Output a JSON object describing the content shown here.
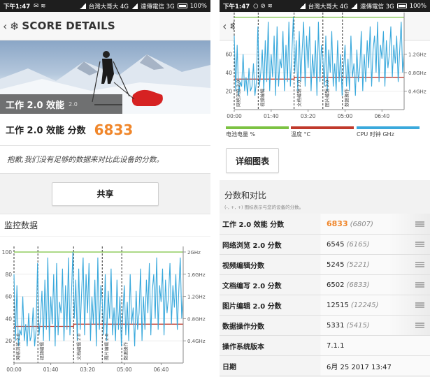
{
  "status_left": {
    "time": "下午1:47",
    "carrier1": "台灣大哥大 4G",
    "carrier2": "遠傳電信 3G",
    "battery": "100%"
  },
  "status_right": {
    "time": "下午1:47",
    "carrier1": "台灣大哥大 4G",
    "carrier2": "遠傳電信 3G",
    "battery": "100%"
  },
  "appbar": {
    "title": "SCORE DETAILS"
  },
  "hero": {
    "label": "工作 2.0 效能",
    "version": "2.0"
  },
  "score": {
    "label": "工作 2.0 效能 分数",
    "value": "6833"
  },
  "sorry_text": "抱歉,我们没有足够的数据来对比此设备的分数。",
  "share_label": "共享",
  "monitor_title": "监控数据",
  "detail_button": "详细图表",
  "compare": {
    "title": "分数和对比",
    "subtitle": "(-, +, +) 图标表示与您的设备的分数。"
  },
  "legend": [
    {
      "label": "电池电量 %",
      "color": "#7cc242"
    },
    {
      "label": "温度 °C",
      "color": "#c0392b"
    },
    {
      "label": "CPU 时钟 GHz",
      "color": "#3aa9dc"
    }
  ],
  "table": [
    {
      "name": "工作 2.0 效能 分数",
      "score": "6833",
      "ref": "(6807)"
    },
    {
      "name": "网络浏览 2.0 分数",
      "score": "6545",
      "ref": "(6165)"
    },
    {
      "name": "视频编辑分数",
      "score": "5245",
      "ref": "(5221)"
    },
    {
      "name": "文档编写 2.0 分数",
      "score": "6502",
      "ref": "(6833)"
    },
    {
      "name": "图片编辑 2.0 分数",
      "score": "12515",
      "ref": "(12245)"
    },
    {
      "name": "数据操作分数",
      "score": "5331",
      "ref": "(5415)"
    },
    {
      "name": "操作系统版本",
      "score": "7.1.1",
      "ref": ""
    },
    {
      "name": "日期",
      "score": "6月 25 2017 13:47",
      "ref": ""
    }
  ],
  "chart_data": [
    {
      "type": "line",
      "title": "",
      "x_ticks": [
        "00:00",
        "01:40",
        "03:20",
        "05:00",
        "06:40"
      ],
      "x_range_minutes": [
        0,
        460
      ],
      "y_left_ticks": [
        20,
        40,
        60,
        80,
        100
      ],
      "y_left_range": [
        0,
        105
      ],
      "y_right_ticks": [
        "0.4GHz",
        "0.8GHz",
        "1.2GHz",
        "1.6GHz",
        "2GHz"
      ],
      "y_right_range_ghz": [
        0,
        2.1
      ],
      "segment_labels": [
        {
          "label": "网络浏览 2.0",
          "start_min": 0
        },
        {
          "label": "视频编辑",
          "start_min": 65
        },
        {
          "label": "文档编辑 2.0",
          "start_min": 165
        },
        {
          "label": "图片编辑 2.0",
          "start_min": 240
        },
        {
          "label": "数据操作",
          "start_min": 293
        }
      ],
      "segment_lines_min": [
        0,
        65,
        162,
        240,
        293
      ],
      "series": [
        {
          "name": "电池电量 %",
          "color": "#7cc242",
          "x": [
            0,
            162,
            163,
            460
          ],
          "values": [
            100,
            100,
            100,
            100
          ]
        },
        {
          "name": "温度 °C",
          "color": "#c0392b",
          "x": [
            0,
            162,
            163,
            460
          ],
          "values": [
            33,
            33,
            35,
            35
          ]
        },
        {
          "name": "CPU 时钟 GHz",
          "color": "#3aa9dc",
          "x": [
            0,
            4,
            8,
            12,
            16,
            20,
            24,
            28,
            32,
            36,
            40,
            44,
            48,
            52,
            56,
            60,
            64,
            68,
            72,
            76,
            80,
            84,
            88,
            92,
            96,
            100,
            104,
            108,
            112,
            116,
            120,
            124,
            128,
            132,
            136,
            140,
            144,
            148,
            152,
            156,
            160,
            164,
            168,
            172,
            176,
            180,
            184,
            188,
            192,
            196,
            200,
            204,
            208,
            212,
            216,
            220,
            224,
            228,
            232,
            236,
            240,
            244,
            248,
            252,
            256,
            260,
            264,
            268,
            272,
            276,
            280,
            284,
            288,
            292,
            296,
            300,
            304,
            308,
            312,
            316,
            320,
            324,
            328,
            332,
            336,
            340,
            344,
            348,
            352,
            356,
            360,
            364,
            368,
            372,
            376,
            380,
            384,
            388,
            392,
            396,
            400,
            404,
            408,
            412,
            416,
            420,
            424,
            428,
            432,
            436,
            440,
            444,
            448,
            452,
            456,
            460
          ],
          "values": [
            1.6,
            0.4,
            1.4,
            0.3,
            0.6,
            0.5,
            1.2,
            0.4,
            0.7,
            0.3,
            0.9,
            0.4,
            0.5,
            1.0,
            0.3,
            0.6,
            1.8,
            0.5,
            0.8,
            1.3,
            0.4,
            1.5,
            0.6,
            1.9,
            0.4,
            1.2,
            0.7,
            1.6,
            0.3,
            1.8,
            0.5,
            1.1,
            0.9,
            1.7,
            0.4,
            1.4,
            0.6,
            1.9,
            0.5,
            1.2,
            2.0,
            0.8,
            1.5,
            0.4,
            1.7,
            0.6,
            1.3,
            1.9,
            0.5,
            1.6,
            0.9,
            1.8,
            0.4,
            1.2,
            0.7,
            1.5,
            0.3,
            1.9,
            0.6,
            1.4,
            1.1,
            0.5,
            1.6,
            0.4,
            1.3,
            0.8,
            1.7,
            0.5,
            1.0,
            0.4,
            1.5,
            0.6,
            1.2,
            0.3,
            0.9,
            1.4,
            0.5,
            1.1,
            0.4,
            1.6,
            0.7,
            1.0,
            0.3,
            1.3,
            0.6,
            0.9,
            1.7,
            0.4,
            1.2,
            0.6,
            1.5,
            0.9,
            1.8,
            0.5,
            1.3,
            1.6,
            0.8,
            1.9,
            0.6,
            1.4,
            1.1,
            1.7,
            0.5,
            1.5,
            0.9,
            1.2,
            1.8,
            0.7,
            1.4,
            1.0,
            1.6,
            0.6,
            1.3,
            1.9,
            0.8,
            1.2
          ]
        }
      ]
    }
  ]
}
